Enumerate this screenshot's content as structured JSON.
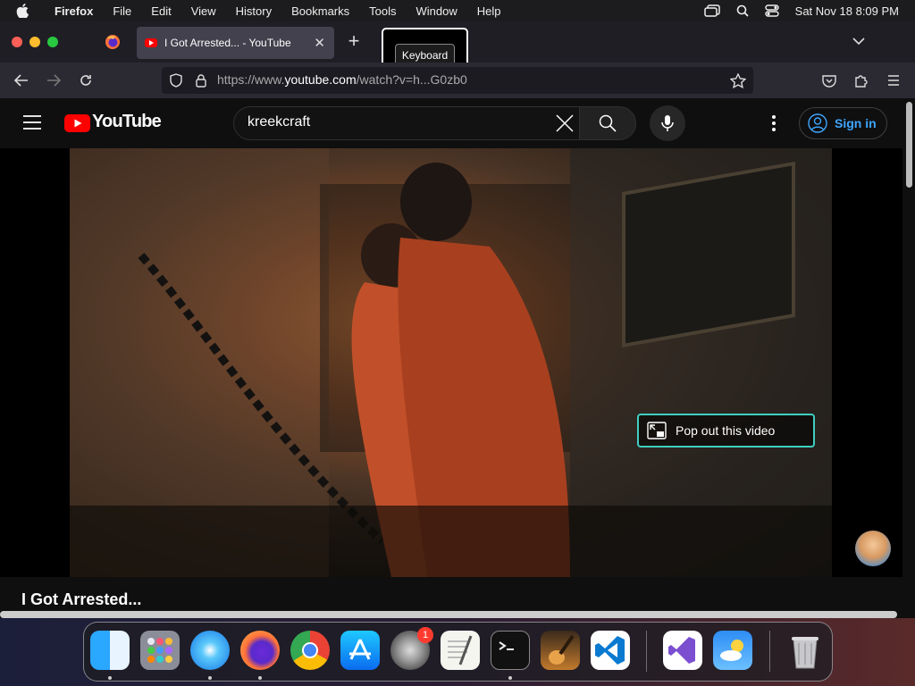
{
  "menubar": {
    "app": "Firefox",
    "items": [
      "File",
      "Edit",
      "View",
      "History",
      "Bookmarks",
      "Tools",
      "Window",
      "Help"
    ],
    "clock": "Sat Nov 18  8:09 PM"
  },
  "tabs": {
    "active_title": "I Got Arrested... - YouTube",
    "keyboard_tooltip": "Keyboard"
  },
  "url": {
    "prefix": "https://www.",
    "domain": "youtube.com",
    "path": "/watch?v=h...G0zb0"
  },
  "youtube": {
    "logo_text": "YouTube",
    "search_value": "kreekcraft",
    "signin_label": "Sign in",
    "popout_label": "Pop out this video",
    "video_title": "I Got Arrested..."
  },
  "dock": {
    "apps": [
      "finder-icon",
      "launchpad-icon",
      "safari-icon",
      "firefox-icon",
      "chrome-icon",
      "app-store-icon",
      "system-settings-icon",
      "textedit-icon",
      "terminal-icon",
      "garageband-icon",
      "vscode-icon",
      "visual-studio-icon",
      "weather-icon",
      "trash-icon"
    ],
    "settings_badge": "1"
  },
  "colors": {
    "youtube_red": "#ff0000",
    "link_blue": "#3ea6ff",
    "popout_border": "#3ecfc0"
  }
}
